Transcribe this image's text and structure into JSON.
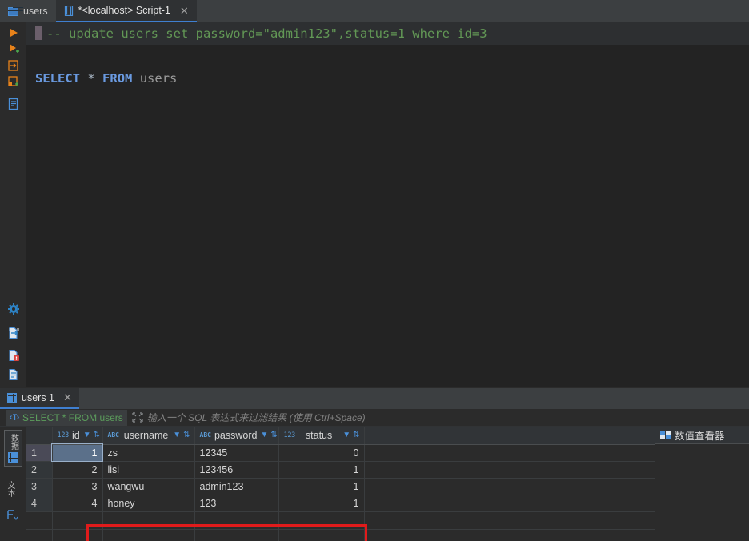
{
  "window": {
    "tabs": [
      {
        "label": "users",
        "icon": "table-grid-icon",
        "active": false,
        "closable": false
      },
      {
        "label": "*<localhost> Script-1",
        "icon": "script-file-icon",
        "active": true,
        "closable": true
      }
    ]
  },
  "editor": {
    "gutter_icons": [
      "run-statement-icon",
      "run-script-icon",
      "execute-to-console-icon",
      "execute-new-console-icon",
      "show-history-icon",
      "settings-gear-icon",
      "more-dots-icon",
      "export-data-icon",
      "document-error-icon",
      "data-preview-icon"
    ],
    "lines": [
      {
        "id": "line-comment",
        "current": true,
        "has_caret": true,
        "tokens": [
          {
            "text": "-- update users set password=\"admin123\",status=1 where id=3",
            "style": "comment"
          }
        ]
      },
      {
        "id": "line-blank-1",
        "current": false,
        "has_caret": false,
        "tokens": []
      },
      {
        "id": "line-select",
        "current": false,
        "has_caret": false,
        "tokens": [
          {
            "text": "SELECT",
            "style": "keyword"
          },
          {
            "text": " ",
            "style": "plain"
          },
          {
            "text": "*",
            "style": "operator"
          },
          {
            "text": " ",
            "style": "plain"
          },
          {
            "text": "FROM",
            "style": "keyword"
          },
          {
            "text": " ",
            "style": "plain"
          },
          {
            "text": "users",
            "style": "identifier"
          }
        ]
      }
    ],
    "splitter_glyph": "▲▼"
  },
  "results": {
    "tab": {
      "label": "users 1",
      "icon": "result-grid-icon",
      "close": "✕"
    },
    "filter": {
      "query": "SELECT * FROM users",
      "expand_icon": "expand-icon",
      "text_filter_icon": "text-filter-icon",
      "placeholder": "输入一个 SQL 表达式来过滤结果 (使用 Ctrl+Space)"
    },
    "side_tabs": [
      {
        "id": "vtab-data",
        "text": "数据",
        "icon": "grid-icon",
        "selected": true
      },
      {
        "id": "vtab-text",
        "text": "文本",
        "icon": "",
        "selected": false
      },
      {
        "id": "vtab-transpose",
        "text": "",
        "icon": "transpose-icon",
        "selected": false
      }
    ],
    "columns": [
      {
        "name": "id",
        "type_tag": "123",
        "type_kind": "number",
        "primary_key": true,
        "align": "right",
        "selected": true,
        "filter_icon": "filter-icon",
        "sort_icon": "sort-icon"
      },
      {
        "name": "username",
        "type_tag": "ABC",
        "type_kind": "text",
        "primary_key": false,
        "align": "left",
        "selected": false,
        "filter_icon": "filter-icon",
        "sort_icon": "sort-icon"
      },
      {
        "name": "password",
        "type_tag": "ABC",
        "type_kind": "text",
        "primary_key": false,
        "align": "left",
        "selected": false,
        "filter_icon": "filter-icon",
        "sort_icon": "sort-icon"
      },
      {
        "name": "status",
        "type_tag": "123",
        "type_kind": "number",
        "primary_key": false,
        "align": "right",
        "selected": false,
        "filter_icon": "filter-icon",
        "sort_icon": "sort-icon"
      }
    ],
    "rows": [
      {
        "num": "1",
        "id": "1",
        "username": "zs",
        "password": "12345",
        "status": "0",
        "selected_cell": "id",
        "highlighted": false
      },
      {
        "num": "2",
        "id": "2",
        "username": "lisi",
        "password": "123456",
        "status": "1",
        "selected_cell": "",
        "highlighted": false
      },
      {
        "num": "3",
        "id": "3",
        "username": "wangwu",
        "password": "admin123",
        "status": "1",
        "selected_cell": "",
        "highlighted": true
      },
      {
        "num": "4",
        "id": "4",
        "username": "honey",
        "password": "123",
        "status": "1",
        "selected_cell": "",
        "highlighted": false
      }
    ],
    "new_row": {
      "num": "",
      "id": "",
      "username": "",
      "password": "",
      "status": ""
    },
    "annotation": {
      "type": "red-rectangle",
      "target_row": "3"
    },
    "value_viewer": {
      "title": "数值查看器",
      "icon": "value-viewer-icon",
      "content": ""
    }
  },
  "colors": {
    "accent": "#4a90d9",
    "comment_green": "#629755",
    "keyword_blue": "#6a9ae0",
    "annotation_red": "#e01b1b",
    "bg_editor": "#232323",
    "bg_panel": "#2b2b2b",
    "bg_tabbar": "#3c3f41"
  }
}
